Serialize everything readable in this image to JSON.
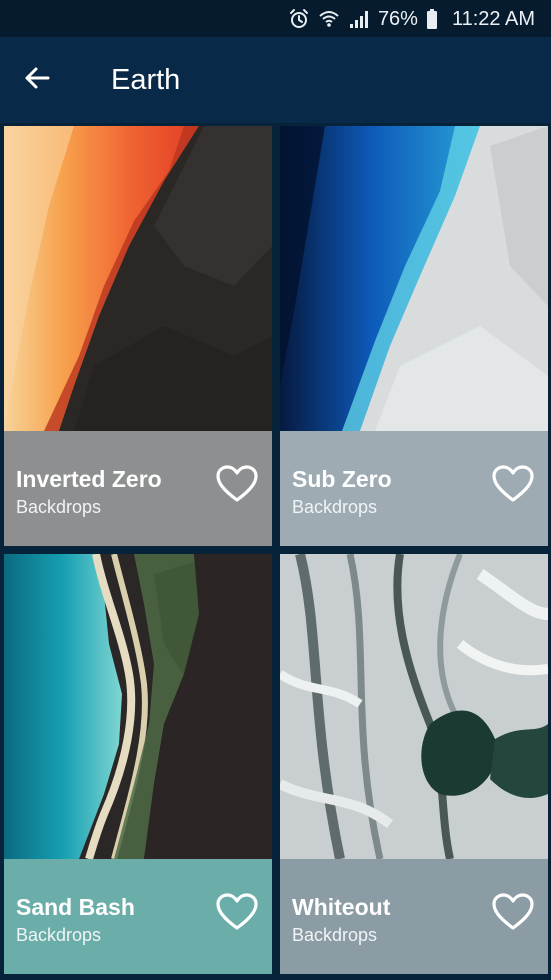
{
  "status_bar": {
    "icons": [
      "alarm-icon",
      "wifi-icon",
      "signal-icon",
      "battery-icon"
    ],
    "battery": "76%",
    "time": "11:22 AM"
  },
  "app_bar": {
    "back_icon": "arrow-left-icon",
    "title": "Earth"
  },
  "cards": [
    {
      "title": "Inverted Zero",
      "subtitle": "Backdrops",
      "caption_color": "#8d8f90",
      "icon": "heart-outline-icon"
    },
    {
      "title": "Sub Zero",
      "subtitle": "Backdrops",
      "caption_color": "#9eabb3",
      "icon": "heart-outline-icon"
    },
    {
      "title": "Sand Bash",
      "subtitle": "Backdrops",
      "caption_color": "#6bada9",
      "icon": "heart-outline-icon"
    },
    {
      "title": "Whiteout",
      "subtitle": "Backdrops",
      "caption_color": "#8c9ca4",
      "icon": "heart-outline-icon"
    }
  ],
  "colors": {
    "status_bar": "#061b2d",
    "app_bar": "#082947",
    "background": "#07233a"
  }
}
